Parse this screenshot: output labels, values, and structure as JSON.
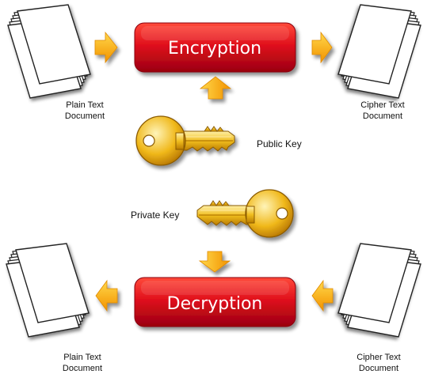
{
  "diagram": {
    "encryption": {
      "label": "Encryption",
      "input": {
        "line1": "Plain Text",
        "line2": "Document"
      },
      "output": {
        "line1": "Cipher Text",
        "line2": "Document"
      },
      "key_label": "Public Key"
    },
    "decryption": {
      "label": "Decryption",
      "input": {
        "line1": "Cipher Text",
        "line2": "Document"
      },
      "output": {
        "line1": "Plain Text",
        "line2": "Document"
      },
      "key_label": "Private Key"
    }
  },
  "colors": {
    "box_red": "#d9001a",
    "box_red_dark": "#8f0010",
    "box_red_light": "#ff3030",
    "arrow_orange": "#f7a400",
    "arrow_yellow": "#ffd23a",
    "key_gold": "#e4a900",
    "key_gold_light": "#ffe17a"
  },
  "icons": [
    "document-stack-icon",
    "right-arrow-icon",
    "left-arrow-icon",
    "up-arrow-icon",
    "down-arrow-icon",
    "key-icon"
  ]
}
